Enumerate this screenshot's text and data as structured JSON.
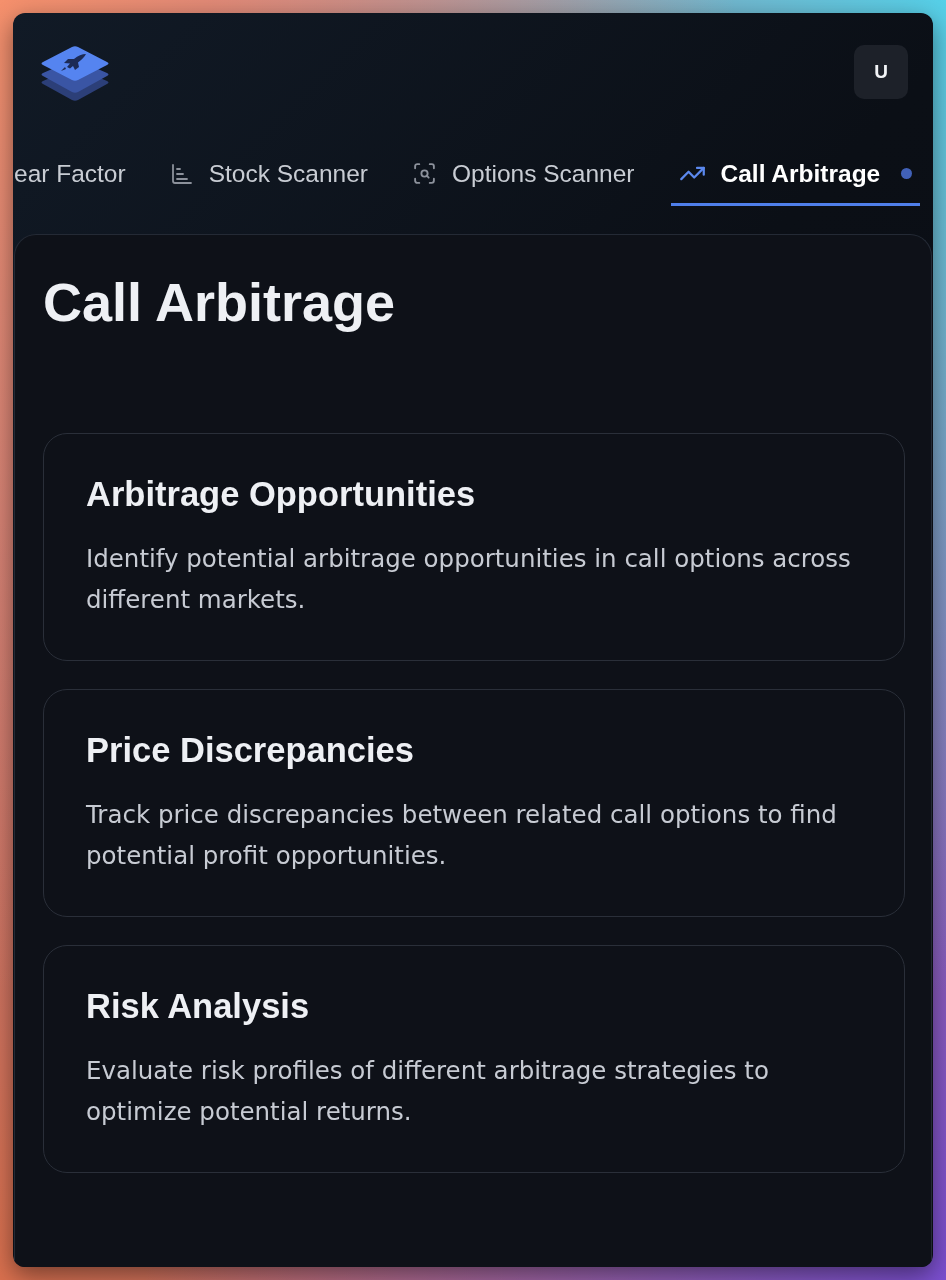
{
  "header": {
    "avatar": {
      "initial": "U"
    }
  },
  "tabs": [
    {
      "label": "ear Factor",
      "kind": "plain",
      "selected": false,
      "badge": false
    },
    {
      "label": "Stock Scanner",
      "kind": "chart",
      "selected": false,
      "badge": false
    },
    {
      "label": "Options Scanner",
      "kind": "scan",
      "selected": false,
      "badge": false
    },
    {
      "label": "Call Arbitrage",
      "kind": "trend",
      "selected": true,
      "badge": true
    }
  ],
  "page": {
    "title": "Call Arbitrage",
    "cards": [
      {
        "title": "Arbitrage Opportunities",
        "description": "Identify potential arbitrage opportunities in call options across different markets."
      },
      {
        "title": "Price Discrepancies",
        "description": "Track price discrepancies between related call options to find potential profit opportunities."
      },
      {
        "title": "Risk Analysis",
        "description": "Evaluate risk profiles of different arbitrage strategies to optimize potential returns."
      }
    ]
  }
}
